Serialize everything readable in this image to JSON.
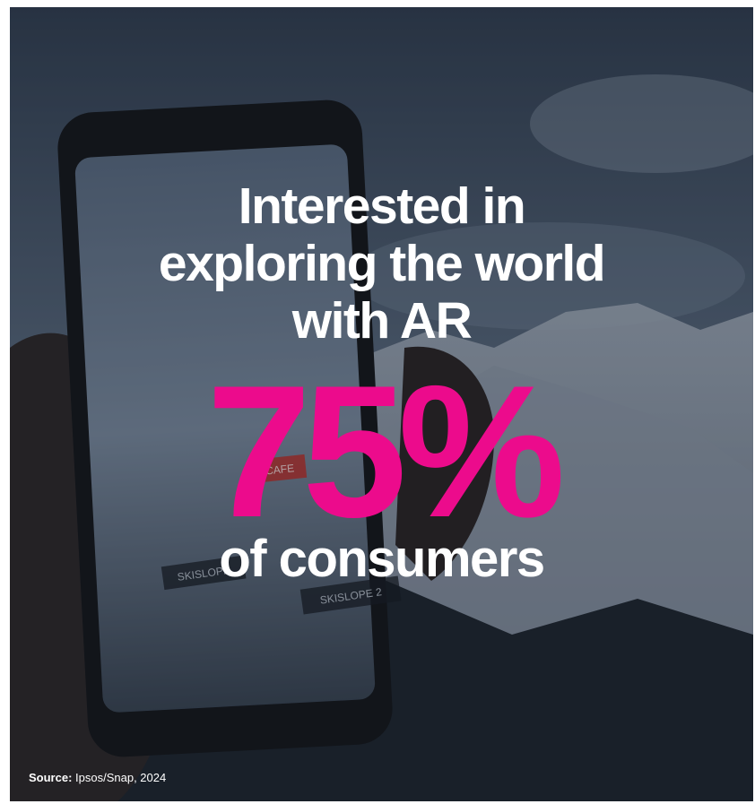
{
  "headline": {
    "lines": [
      "Interested in",
      "exploring the world",
      "with AR"
    ]
  },
  "stat": {
    "value": "75%",
    "caption": "of consumers"
  },
  "phone_screen": {
    "tags": [
      "CAFE",
      "SKISLOPE",
      "SKISLOPE 2"
    ]
  },
  "source": {
    "label": "Source:",
    "text": "Ipsos/Snap, 2024"
  },
  "colors": {
    "accent": "#ec0b8c",
    "text": "#ffffff",
    "overlay": "#2c3644"
  },
  "background": {
    "description_icon": "hand-holding-phone-mountain-photo"
  }
}
